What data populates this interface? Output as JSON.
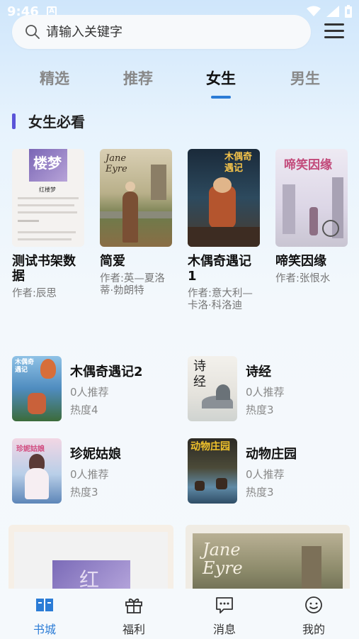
{
  "status_bar": {
    "time": "9:46",
    "notification_letter": "A"
  },
  "search": {
    "placeholder": "请输入关键字",
    "value": ""
  },
  "tabs": [
    {
      "label": "精选",
      "active": false
    },
    {
      "label": "推荐",
      "active": false
    },
    {
      "label": "女生",
      "active": true
    },
    {
      "label": "男生",
      "active": false
    }
  ],
  "section": {
    "title": "女生必看"
  },
  "featured_books": [
    {
      "title": "测试书架数据",
      "author": "作者:辰思",
      "cover_text": "楼梦",
      "cover_subtitle": "红楼梦"
    },
    {
      "title": "简爱",
      "author": "作者:英—夏洛蒂·勃朗特",
      "cover_text": "Jane Eyre"
    },
    {
      "title": "木偶奇遇记1",
      "author": "作者:意大利—卡洛·科洛迪",
      "cover_text": "木偶奇遇记"
    },
    {
      "title": "啼笑因缘",
      "author": "作者:张恨水",
      "cover_text": "啼笑因缘"
    }
  ],
  "list_books": [
    {
      "title": "木偶奇遇记2",
      "recommend": "0人推荐",
      "heat": "热度4",
      "cover_text": "木偶奇遇记"
    },
    {
      "title": "诗经",
      "recommend": "0人推荐",
      "heat": "热度3",
      "cover_text": "诗经"
    },
    {
      "title": "珍妮姑娘",
      "recommend": "0人推荐",
      "heat": "热度3",
      "cover_text": "珍妮姑娘"
    },
    {
      "title": "动物庄园",
      "recommend": "0人推荐",
      "heat": "热度3",
      "cover_text": "动物庄园"
    }
  ],
  "bottom_cards": [
    {
      "cover_text": "红"
    },
    {
      "cover_text": "Jane Eyre"
    }
  ],
  "bottom_nav": [
    {
      "label": "书城",
      "icon": "book-icon",
      "active": true
    },
    {
      "label": "福利",
      "icon": "gift-icon",
      "active": false
    },
    {
      "label": "消息",
      "icon": "message-icon",
      "active": false
    },
    {
      "label": "我的",
      "icon": "profile-icon",
      "active": false
    }
  ],
  "colors": {
    "accent": "#2b7cd6",
    "section_bar": "#5a54d8"
  }
}
